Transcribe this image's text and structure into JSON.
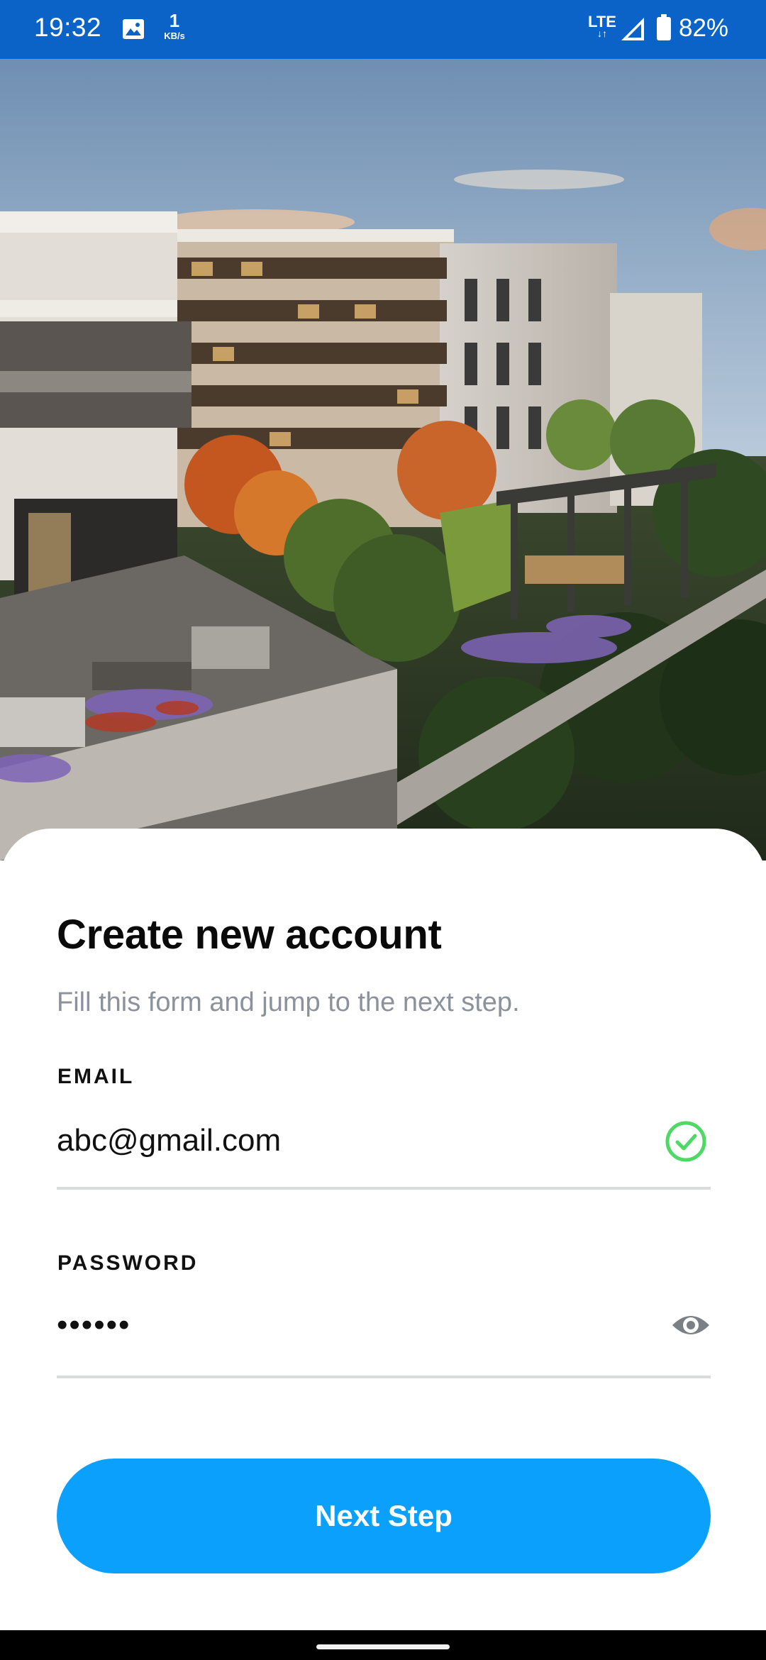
{
  "status_bar": {
    "time": "19:32",
    "net_speed_value": "1",
    "net_speed_unit": "KB/s",
    "network_type": "LTE",
    "battery": "82%",
    "icons": [
      "image-icon",
      "signal-icon",
      "battery-icon"
    ]
  },
  "hero": {
    "icon": "apartment-building-illustration"
  },
  "form": {
    "title": "Create new account",
    "subtitle": "Fill this form and jump to the next step.",
    "email": {
      "label": "EMAIL",
      "value": "abc@gmail.com",
      "valid": true
    },
    "password": {
      "label": "PASSWORD",
      "value": "••••••"
    },
    "submit_label": "Next Step"
  },
  "colors": {
    "status_bar": "#0b63c8",
    "primary_button": "#0aa0fb",
    "valid_check": "#4cd964",
    "muted_text": "#8c929c"
  }
}
